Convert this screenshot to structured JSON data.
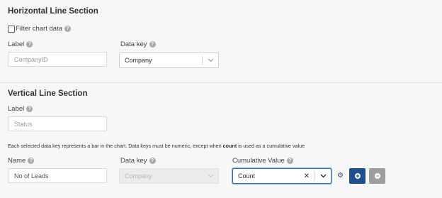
{
  "horizontal": {
    "title": "Horizontal Line Section",
    "filter_label": "Filter chart data",
    "label_label": "Label",
    "label_placeholder": "CompanyID",
    "datakey_label": "Data key",
    "datakey_value": "Company"
  },
  "vertical": {
    "title": "Vertical Line Section",
    "label_label": "Label",
    "label_value": "Status",
    "info_prefix": "Each selected data key represents a bar in the chart. Data keys must be numeric, except when ",
    "info_bold": "count",
    "info_suffix": " is used as a cumulative value",
    "name_label": "Name",
    "name_value": "No of Leads",
    "datakey_label": "Data key",
    "datakey_value": "Company",
    "cumulative_label": "Cumulative Value",
    "cumulative_value": "Count",
    "clear_symbol": "✕"
  },
  "colors": {
    "add_button": "#1f4e8c",
    "remove_button": "#9e9e9e",
    "focus_border": "#2d6aa8"
  },
  "icons": {
    "help": "question-circle",
    "settings": "gear",
    "chevron": "chevron-down",
    "add": "plus-circle",
    "remove": "minus-circle"
  }
}
